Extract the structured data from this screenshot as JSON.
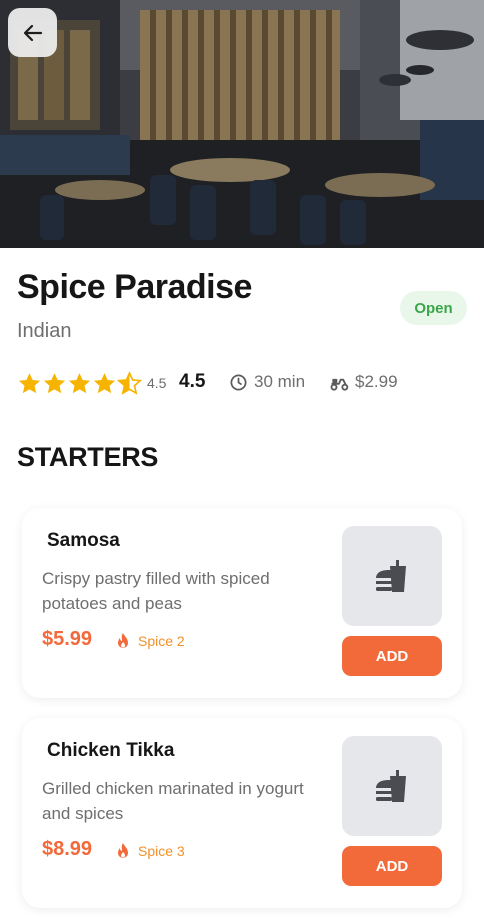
{
  "restaurant": {
    "name": "Spice Paradise",
    "cuisine": "Indian",
    "status": "Open",
    "rating_small": "4.5",
    "rating": "4.5",
    "rating_value": 4.5,
    "delivery_time": "30 min",
    "delivery_fee": "$2.99"
  },
  "icons": {
    "back": "arrow-left-icon",
    "star": "star-icon",
    "clock": "clock-icon",
    "delivery": "scooter-icon",
    "spice": "flame-icon",
    "food": "fastfood-icon"
  },
  "section": {
    "title": "STARTERS"
  },
  "menu": [
    {
      "name": "Samosa",
      "description": "Crispy pastry filled with spiced potatoes and peas",
      "price": "$5.99",
      "spice": "Spice 2",
      "add_label": "ADD"
    },
    {
      "name": "Chicken Tikka",
      "description": "Grilled chicken marinated in yogurt and spices",
      "price": "$8.99",
      "spice": "Spice 3",
      "add_label": "ADD"
    }
  ],
  "colors": {
    "accent": "#f26a3a",
    "star": "#f6b400",
    "open_bg": "#e9f6ea",
    "open_text": "#3aa64a",
    "spice": "#f2902a"
  }
}
